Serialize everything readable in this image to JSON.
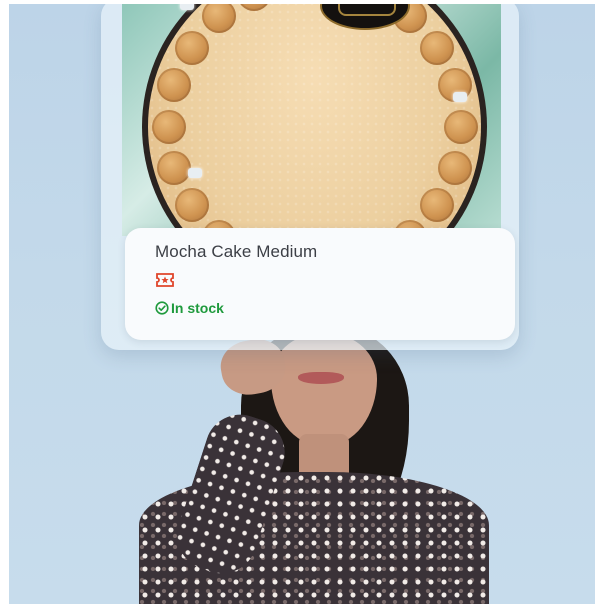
{
  "product": {
    "name": "Mocha Cake Medium",
    "badge_icon": "ticket-icon",
    "stock_icon": "check-circle-icon",
    "stock_status": "In stock"
  },
  "colors": {
    "stock_green": "#1f9a3d",
    "badge_red": "#e0452b",
    "title_gray": "#3c3f46",
    "background_blue": "#c3d9ea"
  }
}
